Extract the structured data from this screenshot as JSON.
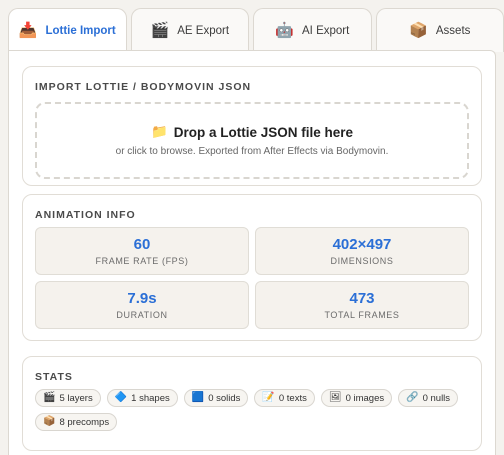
{
  "tabs": [
    {
      "label": "Lottie Import",
      "icon": "📥"
    },
    {
      "label": "AE Export",
      "icon": "🎬"
    },
    {
      "label": "AI Export",
      "icon": "🤖"
    },
    {
      "label": "Assets",
      "icon": "📦"
    }
  ],
  "import": {
    "title": "IMPORT LOTTIE / BODYMOVIN JSON",
    "drop_icon": "📁",
    "drop_title": "Drop a Lottie JSON file here",
    "drop_subtitle": "or click to browse. Exported from After Effects via Bodymovin."
  },
  "info": {
    "title": "ANIMATION INFO",
    "cells": [
      {
        "value": "60",
        "label": "FRAME RATE (FPS)"
      },
      {
        "value": "402×497",
        "label": "DIMENSIONS"
      },
      {
        "value": "7.9s",
        "label": "DURATION"
      },
      {
        "value": "473",
        "label": "TOTAL FRAMES"
      }
    ]
  },
  "stats": {
    "title": "STATS",
    "items": [
      {
        "icon": "🎬",
        "label": "5 layers"
      },
      {
        "icon": "🔷",
        "label": "1 shapes"
      },
      {
        "icon": "🟦",
        "label": "0 solids"
      },
      {
        "icon": "📝",
        "label": "0 texts"
      },
      {
        "icon": "🖼",
        "label": "0 images"
      },
      {
        "icon": "🔗",
        "label": "0 nulls"
      },
      {
        "icon": "📦",
        "label": "8 precomps"
      }
    ]
  },
  "colors": {
    "accent": "#2b6fd6",
    "background": "#f4f2ee"
  }
}
